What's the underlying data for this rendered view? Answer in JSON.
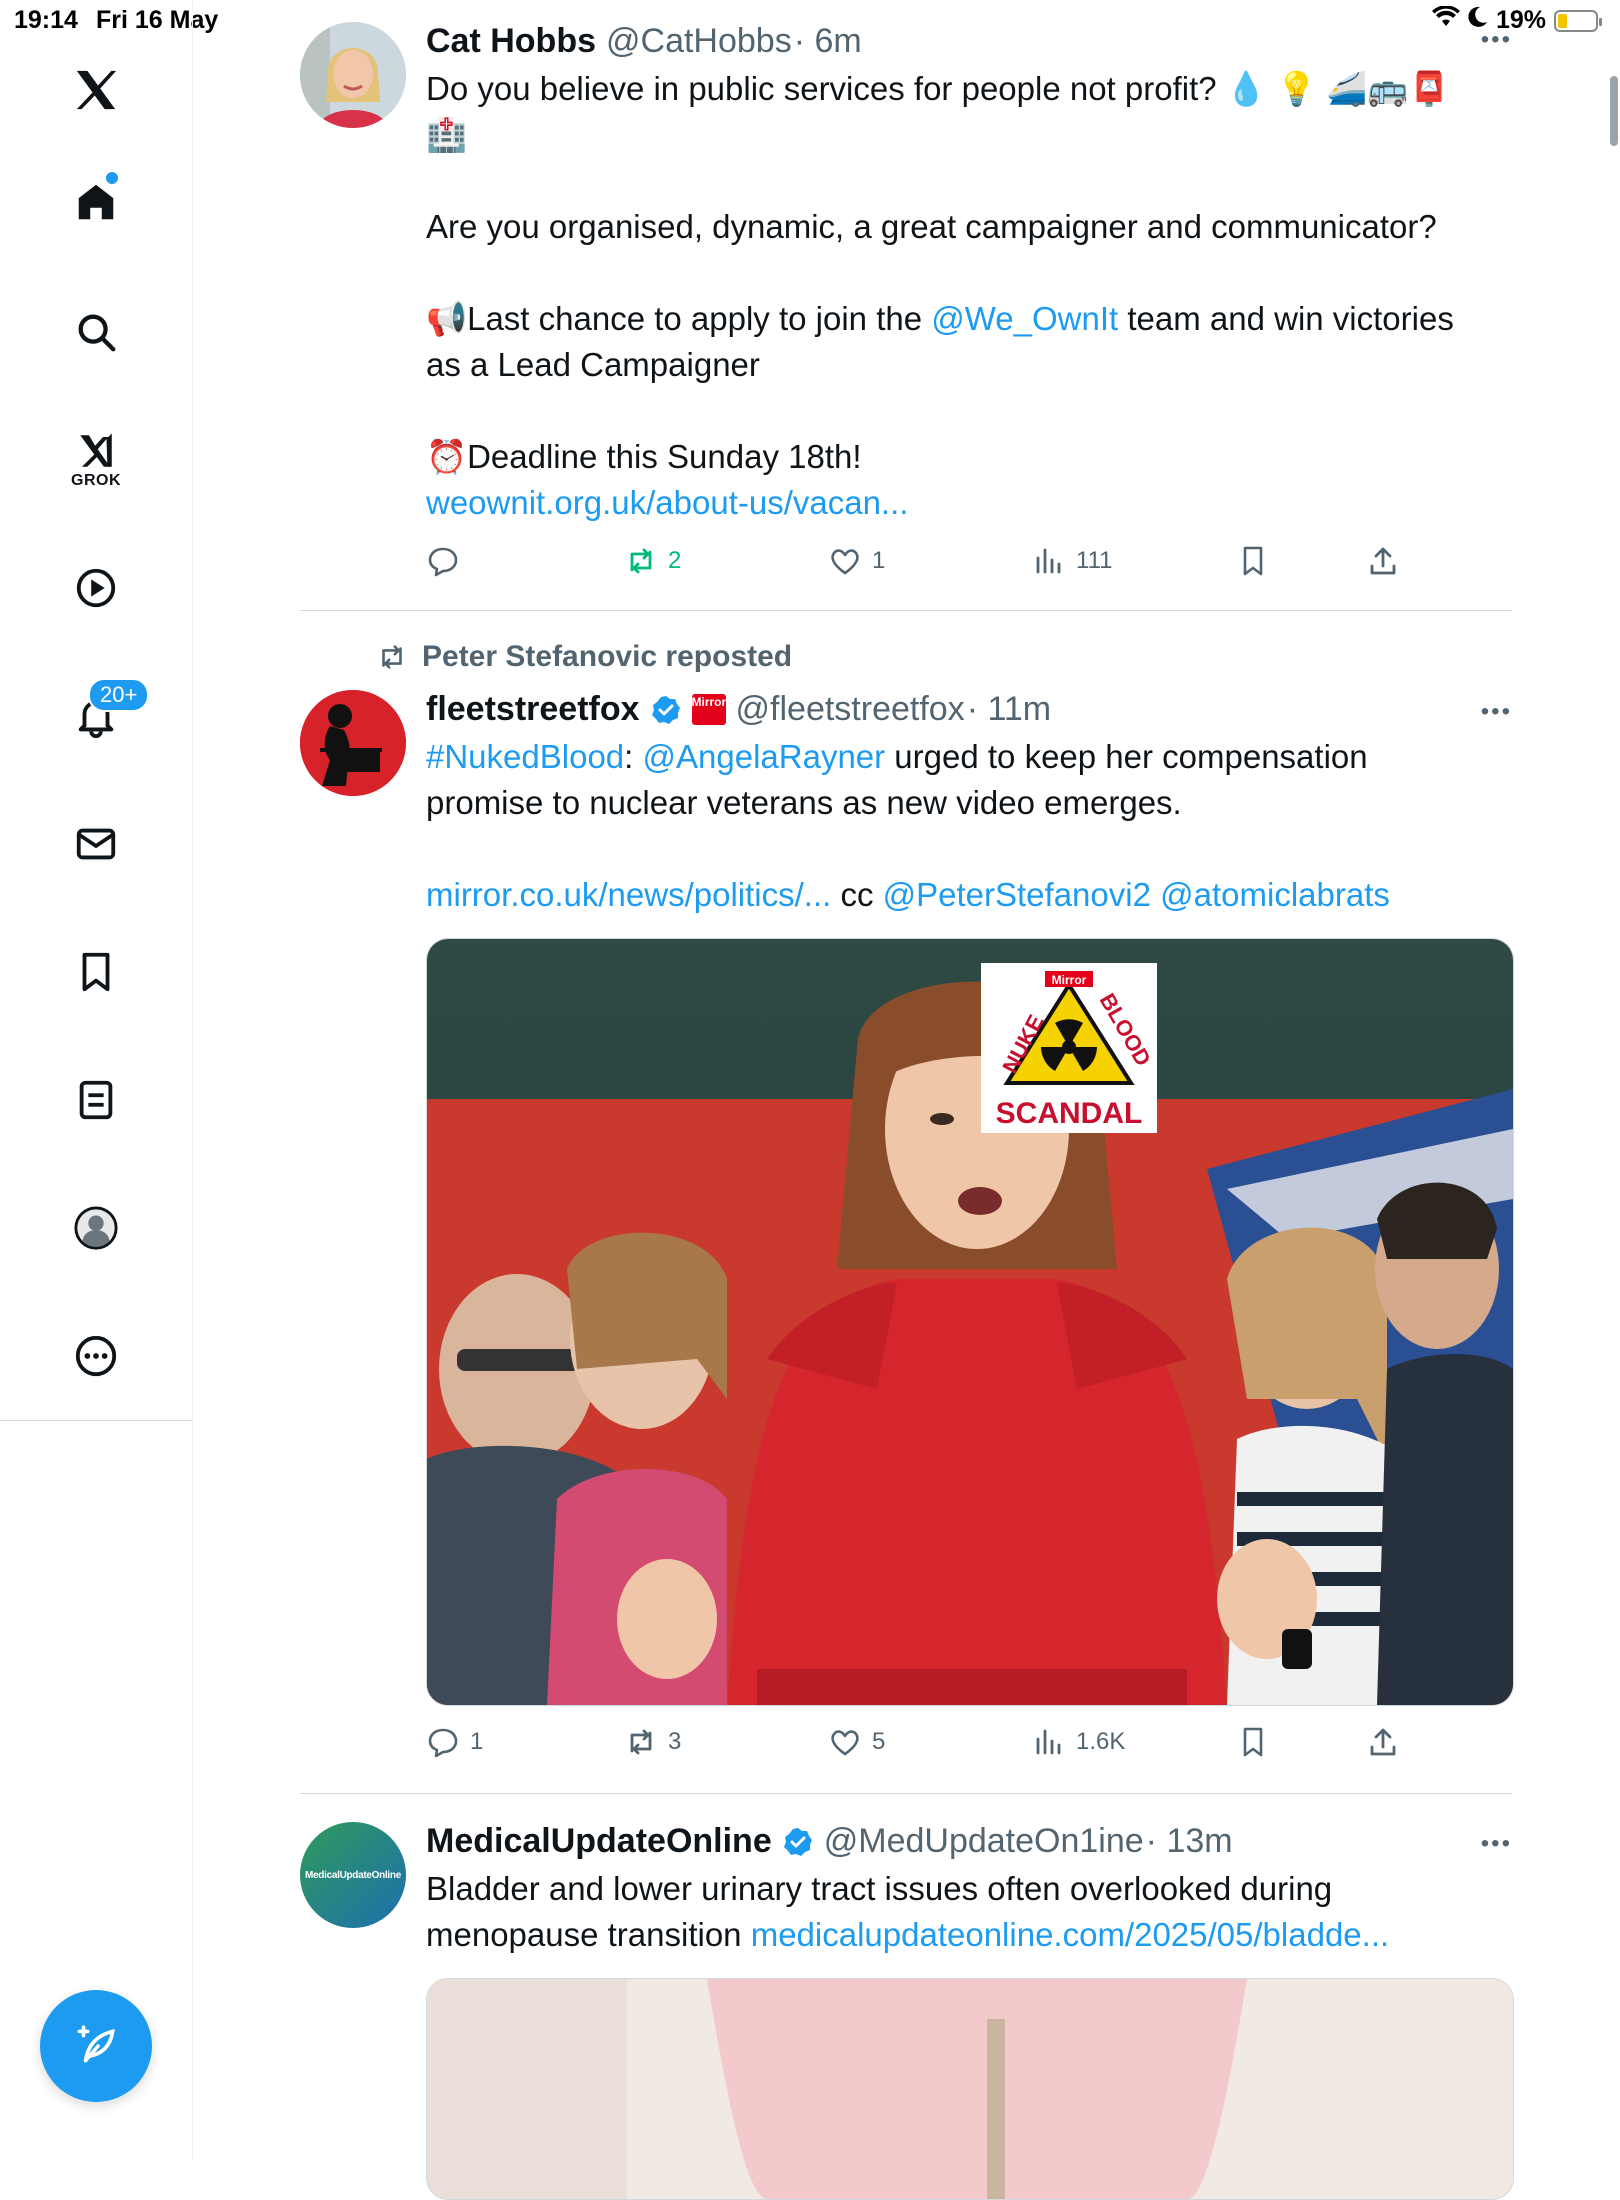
{
  "status_bar": {
    "time": "19:14",
    "date": "Fri 16 May",
    "battery": "19%",
    "battery_level": 0.19
  },
  "sidebar": {
    "logo": "x-logo-icon",
    "items": [
      {
        "name": "home",
        "icon": "home-icon",
        "has_dot": true
      },
      {
        "name": "explore",
        "icon": "search-icon"
      },
      {
        "name": "grok",
        "icon": "grok-icon",
        "label": "GROK"
      },
      {
        "name": "videos",
        "icon": "play-icon"
      },
      {
        "name": "notifications",
        "icon": "bell-icon",
        "badge": "20+"
      },
      {
        "name": "messages",
        "icon": "mail-icon"
      },
      {
        "name": "bookmarks",
        "icon": "bookmark-icon"
      },
      {
        "name": "lists",
        "icon": "list-icon"
      },
      {
        "name": "profile",
        "icon": "profile-icon"
      },
      {
        "name": "more",
        "icon": "more-icon"
      }
    ],
    "compose_icon": "compose-icon"
  },
  "colors": {
    "accent": "#1d9bf0",
    "retweet_green": "#00ba7c",
    "text": "#0f1419",
    "muted": "#536471"
  },
  "tweets": [
    {
      "name": "Cat Hobbs",
      "handle": "@CatHobbs",
      "time": "· 6m",
      "body": {
        "l1": "Do you believe in public services for people not profit? 💧 💡 🚄🚌📮",
        "l1b": "🏥",
        "l2": "Are you organised, dynamic, a great campaigner and communicator?",
        "l3a": "📢Last chance to apply to join the ",
        "l3link": "@We_OwnIt",
        "l3b": " team and win victories",
        "l3c": "as a Lead Campaigner",
        "l4": "⏰Deadline this Sunday 18th!",
        "l5link": "weownit.org.uk/about-us/vacan..."
      },
      "stats": {
        "replies": "",
        "retweets": "2",
        "likes": "1",
        "views": "111"
      }
    },
    {
      "repost_by": "Peter Stefanovic reposted",
      "name": "fleetstreetfox",
      "handle": "@fleetstreetfox",
      "time": "· 11m",
      "affiliate_badge": "Mirror",
      "body": {
        "hashtag": "#NukedBlood",
        "colon": ": ",
        "mention1": "@AngelaRayner",
        "text1": " urged to keep her compensation",
        "text2": "promise to nuclear veterans as new video emerges.",
        "link": "mirror.co.uk/news/politics/...",
        "cc": " cc ",
        "mention2": "@PeterStefanovi2",
        "space": " ",
        "mention3": "@atomiclabrats"
      },
      "media_overlay": {
        "brand": "Mirror",
        "top_left": "NUKE",
        "top_right": "BLOOD",
        "bottom": "SCANDAL"
      },
      "stats": {
        "replies": "1",
        "retweets": "3",
        "likes": "5",
        "views": "1.6K"
      }
    },
    {
      "name": "MedicalUpdateOnline",
      "handle": "@MedUpdateOn1ine",
      "time": "· 13m",
      "avatar_text": "MedicalUpdateOnline",
      "body": {
        "text1": "Bladder and lower urinary tract issues often overlooked during",
        "text2": "menopause transition ",
        "link": "medicalupdateonline.com/2025/05/bladde..."
      }
    }
  ]
}
